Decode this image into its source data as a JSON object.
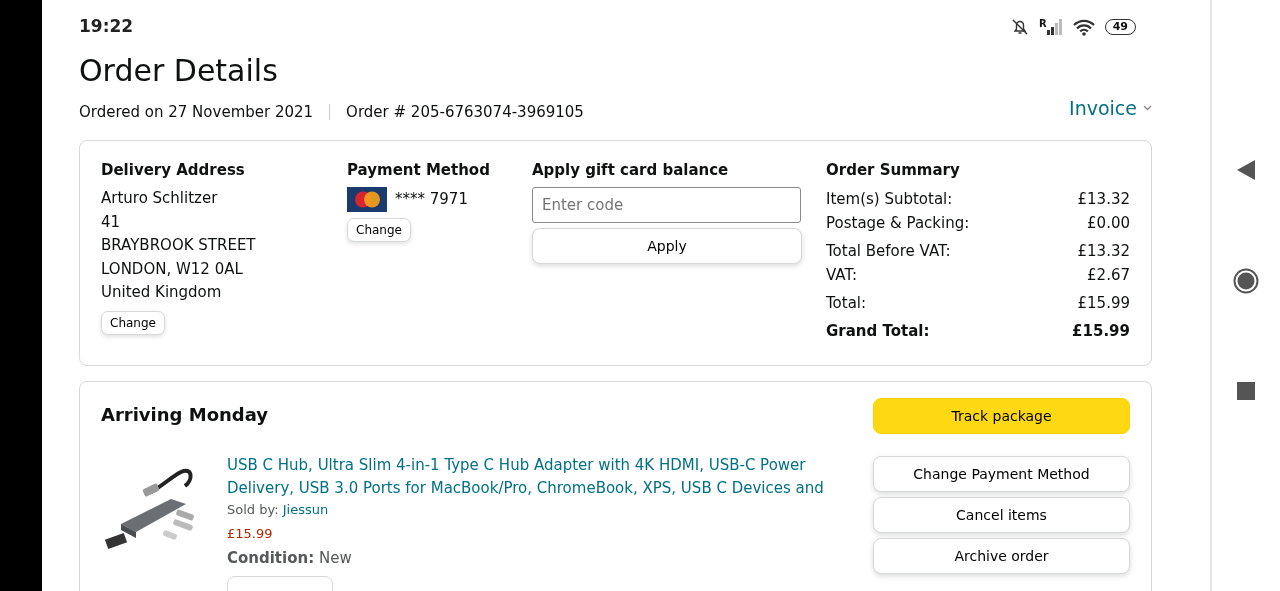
{
  "status_bar": {
    "time": "19:22",
    "roaming": "R",
    "battery": "49"
  },
  "title": "Order Details",
  "ordered_on": "Ordered on 27 November 2021",
  "order_number": "Order # 205-6763074-3969105",
  "invoice": "Invoice",
  "delivery_address": {
    "heading": "Delivery Address",
    "lines": [
      "Arturo Schlitzer",
      "41",
      "BRAYBROOK STREET",
      "LONDON, W12 0AL",
      "United Kingdom"
    ],
    "button": "Change"
  },
  "payment_method": {
    "heading": "Payment Method",
    "card": "**** 7971",
    "button": "Change"
  },
  "gift_card": {
    "heading": "Apply gift card balance",
    "placeholder": "Enter code",
    "button": "Apply"
  },
  "order_summary": {
    "heading": "Order Summary",
    "groups": [
      [
        {
          "label": "Item(s) Subtotal:",
          "value": "£13.32",
          "bold": false
        },
        {
          "label": "Postage & Packing:",
          "value": "£0.00",
          "bold": false
        }
      ],
      [
        {
          "label": "Total Before VAT:",
          "value": "£13.32",
          "bold": false
        },
        {
          "label": "VAT:",
          "value": "£2.67",
          "bold": false
        }
      ],
      [
        {
          "label": "Total:",
          "value": "£15.99",
          "bold": false
        }
      ],
      [
        {
          "label": "Grand Total:",
          "value": "£15.99",
          "bold": true
        }
      ]
    ]
  },
  "shipment": {
    "heading": "Arriving Monday",
    "item": {
      "title": "USB C Hub, Ultra Slim 4-in-1 Type C Hub Adapter with 4K HDMI, USB-C Power Delivery, USB 3.0 Ports for MacBook/Pro, ChromeBook, XPS, USB C Devices and",
      "sold_by_label": "Sold by:",
      "seller": "Jiessun",
      "price": "£15.99",
      "condition_label": "Condition:",
      "condition": "New"
    },
    "buttons": [
      {
        "label": "Track package",
        "kind": "primary"
      },
      {
        "label": "Change Payment Method",
        "kind": "secondary"
      },
      {
        "label": "Cancel items",
        "kind": "secondary"
      },
      {
        "label": "Archive order",
        "kind": "secondary"
      }
    ]
  }
}
